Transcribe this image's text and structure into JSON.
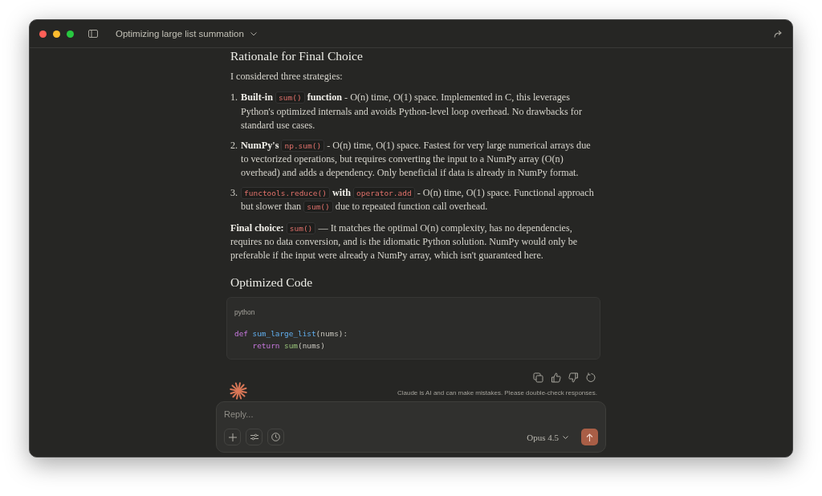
{
  "window": {
    "title": "Optimizing large list summation"
  },
  "message": {
    "heading": "Rationale for Final Choice",
    "intro": "I considered three strategies:",
    "items": [
      {
        "number": "1.",
        "parts": [
          {
            "kind": "text",
            "text": "**Built-in** "
          },
          {
            "kind": "code",
            "text": "sum()"
          },
          {
            "kind": "text",
            "text": " **function** - O(n) time, O(1) space. Implemented in C, this leverages Python's optimized internals and avoids Python-level loop overhead. No drawbacks for standard use cases."
          }
        ]
      },
      {
        "number": "2.",
        "parts": [
          {
            "kind": "text",
            "text": "**NumPy's** "
          },
          {
            "kind": "code",
            "text": "np.sum()"
          },
          {
            "kind": "text",
            "text": " - O(n) time, O(1) space. Fastest for very large numerical arrays due to vectorized operations, but requires converting the input to a NumPy array (O(n) overhead) and adds a dependency. Only beneficial if data is already in NumPy format."
          }
        ]
      },
      {
        "number": "3.",
        "parts": [
          {
            "kind": "code",
            "text": "functools.reduce()"
          },
          {
            "kind": "text",
            "text": " **with** "
          },
          {
            "kind": "code",
            "text": "operator.add"
          },
          {
            "kind": "text",
            "text": " - O(n) time, O(1) space. Functional approach but slower than "
          },
          {
            "kind": "code",
            "text": "sum()"
          },
          {
            "kind": "text",
            "text": " due to repeated function call overhead."
          }
        ]
      }
    ],
    "conclusion": [
      {
        "kind": "text",
        "text": "**Final choice:** "
      },
      {
        "kind": "code",
        "text": "sum()"
      },
      {
        "kind": "text",
        "text": " — It matches the optimal O(n) complexity, has no dependencies, requires no data conversion, and is the idiomatic Python solution. NumPy would only be preferable if the input were already a NumPy array, which isn't guaranteed here."
      }
    ],
    "code_heading": "Optimized Code",
    "code_block": {
      "language": "python",
      "lines": [
        {
          "indented": false,
          "tokens": [
            {
              "kind": "keyword",
              "text": "def"
            },
            {
              "kind": "function",
              "text": "sum_large_list"
            },
            {
              "kind": "plain",
              "text": "(nums):"
            }
          ]
        },
        {
          "indented": true,
          "tokens": [
            {
              "kind": "keyword",
              "text": "return"
            },
            {
              "kind": "builtin",
              "text": "sum"
            },
            {
              "kind": "plain",
              "text": "(nums)"
            }
          ]
        }
      ]
    },
    "disclaimer": "Claude is AI and can make mistakes. Please double-check responses."
  },
  "composer": {
    "placeholder": "Reply...",
    "model": "Opus 4.5"
  }
}
